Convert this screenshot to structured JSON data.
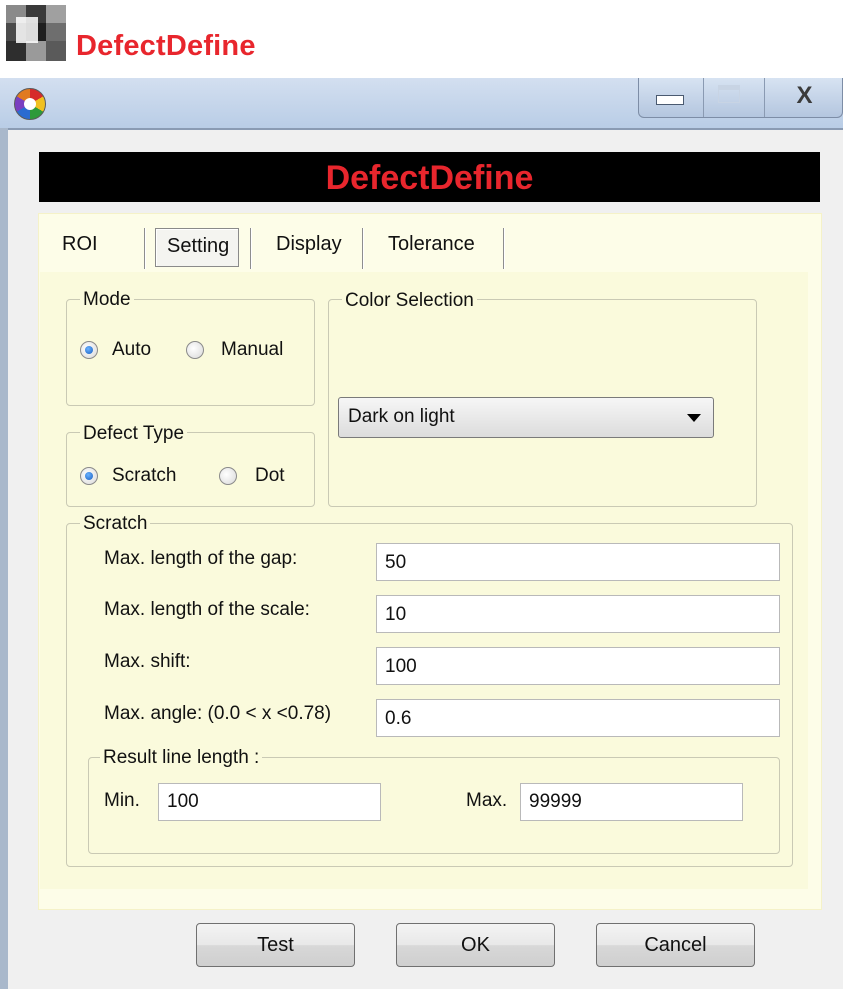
{
  "doc": {
    "title": "DefectDefine"
  },
  "window": {
    "close_glyph": "X"
  },
  "banner": {
    "title": "DefectDefine"
  },
  "tabs": [
    {
      "label": "ROI"
    },
    {
      "label": "Setting",
      "active": true
    },
    {
      "label": "Display"
    },
    {
      "label": "Tolerance"
    }
  ],
  "mode": {
    "legend": "Mode",
    "options": [
      {
        "label": "Auto",
        "checked": true
      },
      {
        "label": "Manual",
        "checked": false
      }
    ]
  },
  "color_selection": {
    "legend": "Color Selection",
    "selected": "Dark on light"
  },
  "defect_type": {
    "legend": "Defect Type",
    "options": [
      {
        "label": "Scratch",
        "checked": true
      },
      {
        "label": "Dot",
        "checked": false
      }
    ]
  },
  "scratch": {
    "legend": "Scratch",
    "fields": [
      {
        "label": "Max. length of the gap:",
        "value": "50"
      },
      {
        "label": "Max. length of the scale:",
        "value": "10"
      },
      {
        "label": "Max. shift:",
        "value": "100"
      },
      {
        "label": "Max. angle: (0.0 < x <0.78)",
        "value": "0.6"
      }
    ],
    "result_line": {
      "legend": "Result line length :",
      "min_label": "Min.",
      "min_value": "100",
      "max_label": "Max.",
      "max_value": "99999"
    }
  },
  "buttons": {
    "test": "Test",
    "ok": "OK",
    "cancel": "Cancel"
  }
}
